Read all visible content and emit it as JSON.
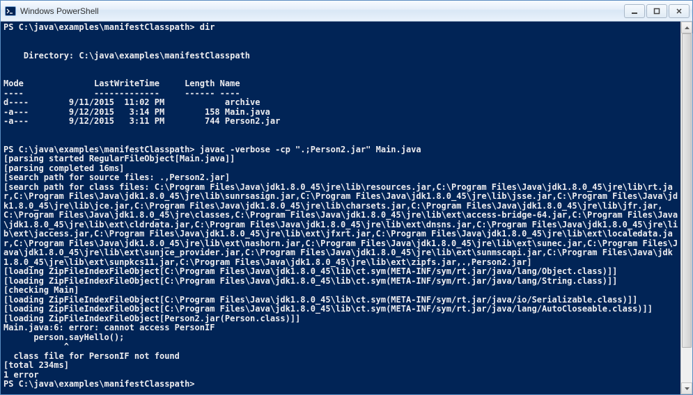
{
  "window": {
    "title": "Windows PowerShell"
  },
  "prompt1": "PS C:\\java\\examples\\manifestClasspath> ",
  "cmd1": "dir",
  "dir_header1": "    Directory: C:\\java\\examples\\manifestClasspath",
  "columns": {
    "mode": "Mode",
    "lwt": "LastWriteTime",
    "length": "Length",
    "name": "Name"
  },
  "underlines": {
    "mode": "----",
    "lwt": "-------------",
    "length": "------",
    "name": "----"
  },
  "rows": [
    {
      "mode": "d----",
      "date": "9/11/2015",
      "time": "11:02 PM",
      "length": "",
      "name": "archive"
    },
    {
      "mode": "-a---",
      "date": "9/12/2015",
      "time": " 3:14 PM",
      "length": "158",
      "name": "Main.java"
    },
    {
      "mode": "-a---",
      "date": "9/12/2015",
      "time": " 3:11 PM",
      "length": "744",
      "name": "Person2.jar"
    }
  ],
  "prompt2": "PS C:\\java\\examples\\manifestClasspath> ",
  "cmd2": "javac -verbose -cp \".;Person2.jar\" Main.java",
  "verbose": [
    "[parsing started RegularFileObject[Main.java]]",
    "[parsing completed 16ms]",
    "[search path for source files: .,Person2.jar]",
    "[search path for class files: C:\\Program Files\\Java\\jdk1.8.0_45\\jre\\lib\\resources.jar,C:\\Program Files\\Java\\jdk1.8.0_45\\jre\\lib\\rt.jar,C:\\Program Files\\Java\\jdk1.8.0_45\\jre\\lib\\sunrsasign.jar,C:\\Program Files\\Java\\jdk1.8.0_45\\jre\\lib\\jsse.jar,C:\\Program Files\\Java\\jdk1.8.0_45\\jre\\lib\\jce.jar,C:\\Program Files\\Java\\jdk1.8.0_45\\jre\\lib\\charsets.jar,C:\\Program Files\\Java\\jdk1.8.0_45\\jre\\lib\\jfr.jar,C:\\Program Files\\Java\\jdk1.8.0_45\\jre\\classes,C:\\Program Files\\Java\\jdk1.8.0_45\\jre\\lib\\ext\\access-bridge-64.jar,C:\\Program Files\\Java\\jdk1.8.0_45\\jre\\lib\\ext\\cldrdata.jar,C:\\Program Files\\Java\\jdk1.8.0_45\\jre\\lib\\ext\\dnsns.jar,C:\\Program Files\\Java\\jdk1.8.0_45\\jre\\lib\\ext\\jaccess.jar,C:\\Program Files\\Java\\jdk1.8.0_45\\jre\\lib\\ext\\jfxrt.jar,C:\\Program Files\\Java\\jdk1.8.0_45\\jre\\lib\\ext\\localedata.jar,C:\\Program Files\\Java\\jdk1.8.0_45\\jre\\lib\\ext\\nashorn.jar,C:\\Program Files\\Java\\jdk1.8.0_45\\jre\\lib\\ext\\sunec.jar,C:\\Program Files\\Java\\jdk1.8.0_45\\jre\\lib\\ext\\sunjce_provider.jar,C:\\Program Files\\Java\\jdk1.8.0_45\\jre\\lib\\ext\\sunmscapi.jar,C:\\Program Files\\Java\\jdk1.8.0_45\\jre\\lib\\ext\\sunpkcs11.jar,C:\\Program Files\\Java\\jdk1.8.0_45\\jre\\lib\\ext\\zipfs.jar,.,Person2.jar]",
    "[loading ZipFileIndexFileObject[C:\\Program Files\\Java\\jdk1.8.0_45\\lib\\ct.sym(META-INF/sym/rt.jar/java/lang/Object.class)]]",
    "[loading ZipFileIndexFileObject[C:\\Program Files\\Java\\jdk1.8.0_45\\lib\\ct.sym(META-INF/sym/rt.jar/java/lang/String.class)]]",
    "[checking Main]",
    "[loading ZipFileIndexFileObject[C:\\Program Files\\Java\\jdk1.8.0_45\\lib\\ct.sym(META-INF/sym/rt.jar/java/io/Serializable.class)]]",
    "[loading ZipFileIndexFileObject[C:\\Program Files\\Java\\jdk1.8.0_45\\lib\\ct.sym(META-INF/sym/rt.jar/java/lang/AutoCloseable.class)]]",
    "[loading ZipFileIndexFileObject[Person2.jar(Person.class)]]",
    "Main.java:6: error: cannot access PersonIF",
    "      person.sayHello();",
    "            ^",
    "  class file for PersonIF not found",
    "[total 234ms]",
    "1 error"
  ],
  "prompt3": "PS C:\\java\\examples\\manifestClasspath> "
}
